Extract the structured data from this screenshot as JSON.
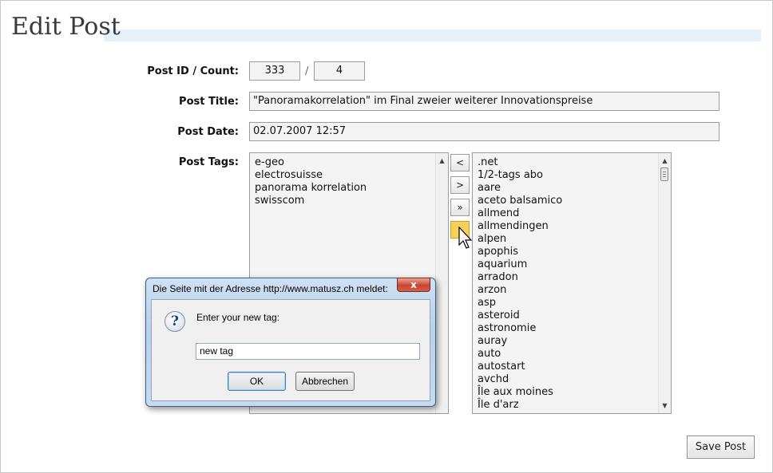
{
  "page": {
    "title": "Edit Post"
  },
  "form": {
    "post_id_label": "Post ID / Count:",
    "post_id": "333",
    "separator": "/",
    "count": "4",
    "title_label": "Post Title:",
    "title_value": "\"Panoramakorrelation\" im Final zweier weiterer Innovationspreise",
    "date_label": "Post Date:",
    "date_value": "02.07.2007 12:57",
    "tags_label": "Post Tags:"
  },
  "selected_tags": [
    "e-geo",
    "electrosuisse",
    "panorama korrelation",
    "swisscom"
  ],
  "available_tags": [
    ".net",
    "1/2-tags abo",
    "aare",
    "aceto balsamico",
    "allmend",
    "allmendingen",
    "alpen",
    "apophis",
    "aquarium",
    "arradon",
    "arzon",
    "asp",
    "asteroid",
    "astronomie",
    "auray",
    "auto",
    "autostart",
    "avchd",
    "Île aux moines",
    "Île d'arz"
  ],
  "move_buttons": {
    "remove": "<",
    "add": ">",
    "add_all": "»"
  },
  "save_label": "Save Post",
  "dialog": {
    "title": "Die Seite mit der Adresse http://www.matusz.ch meldet:",
    "close": "x",
    "icon": "question-icon",
    "message": "Enter your new tag:",
    "input_value": "new tag",
    "ok": "OK",
    "cancel": "Abbrechen"
  },
  "colors": {
    "title_band": "#e4f1fb",
    "field_bg": "#f4f4f4",
    "dialog_frame": "#b9d1ea",
    "close_red": "#c9462f"
  }
}
